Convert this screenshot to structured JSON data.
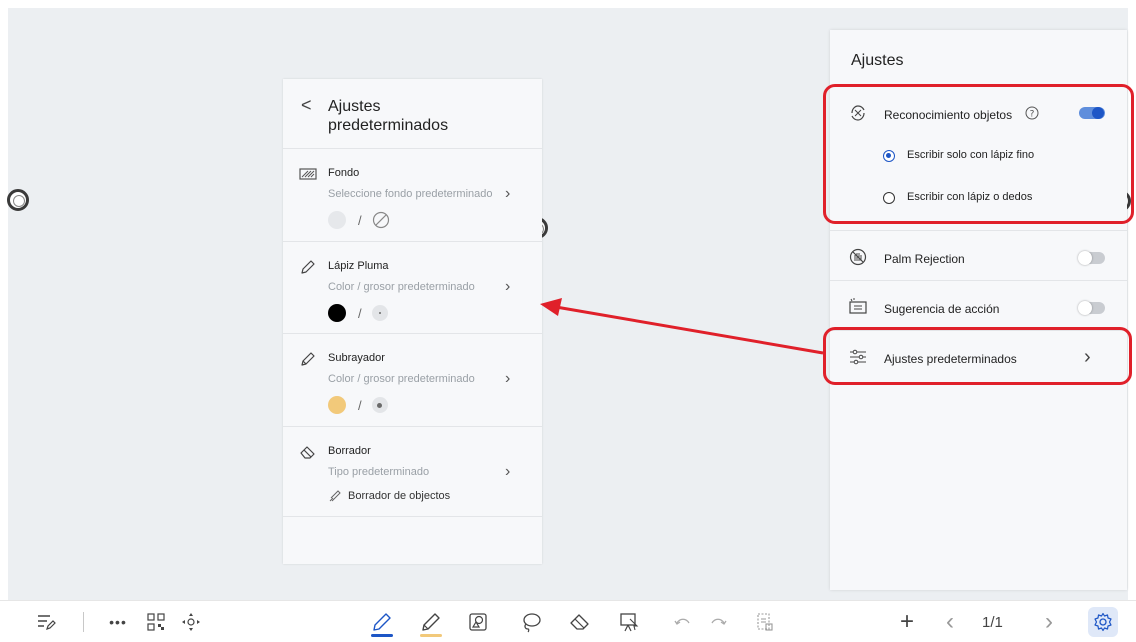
{
  "defaults_panel": {
    "back_glyph": "<",
    "title": "Ajustes predeterminados",
    "sections": [
      {
        "icon": "background-icon",
        "title": "Fondo",
        "subtitle": "Seleccione fondo predeterminado",
        "separator": "/"
      },
      {
        "icon": "pen-icon",
        "title": "Lápiz Pluma",
        "subtitle": "Color / grosor predeterminado",
        "color": "#000000",
        "separator": "/"
      },
      {
        "icon": "highlighter-icon",
        "title": "Subrayador",
        "subtitle": "Color / grosor predeterminado",
        "color": "#f2c97a",
        "separator": "/"
      },
      {
        "icon": "eraser-icon",
        "title": "Borrador",
        "subtitle": "Tipo predeterminado",
        "eraser_type": "Borrador de objectos"
      }
    ]
  },
  "settings_panel": {
    "title": "Ajustes",
    "object_recognition": {
      "label": "Reconocimiento objetos",
      "enabled": true
    },
    "radio_options": [
      {
        "label": "Escribir solo con lápiz fino",
        "checked": true
      },
      {
        "label": "Escribir con lápiz o dedos",
        "checked": false
      }
    ],
    "palm_rejection": {
      "label": "Palm Rejection",
      "enabled": false
    },
    "action_suggestion": {
      "label": "Sugerencia de acción",
      "enabled": false
    },
    "default_settings": {
      "label": "Ajustes predeterminados"
    }
  },
  "toolbar": {
    "page_indicator": "1/1",
    "pen_color": "#1d56c6",
    "highlighter_color": "#f2c97a"
  },
  "colors": {
    "accent": "#1d56c6",
    "annotation_red": "#e0202a"
  }
}
